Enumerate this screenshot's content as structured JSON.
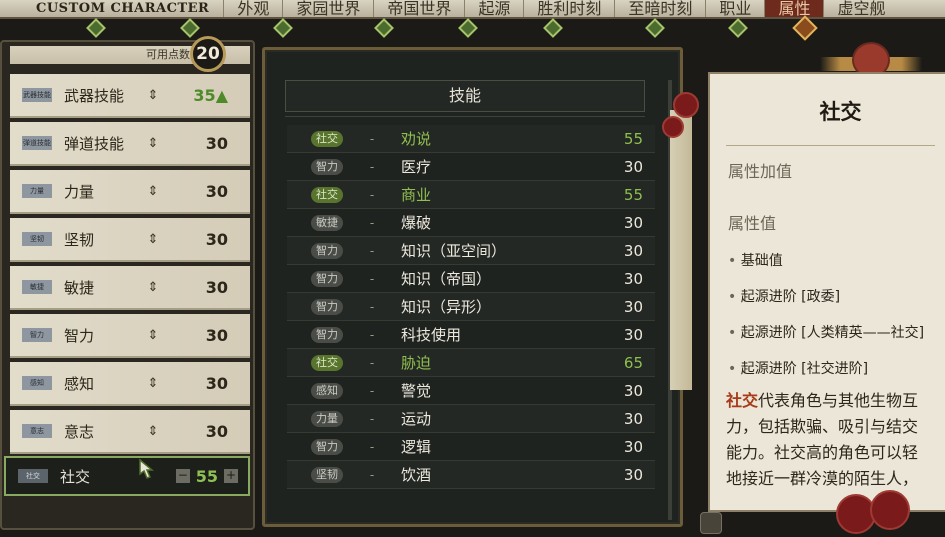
{
  "topbar": {
    "title": "CUSTOM CHARACTER",
    "tabs": [
      "外观",
      "家园世界",
      "帝国世界",
      "起源",
      "胜利时刻",
      "至暗时刻",
      "职业",
      "属性",
      "虚空舰"
    ]
  },
  "points": {
    "label": "可用点数",
    "value": "20"
  },
  "characteristics": [
    {
      "badge": "武器技能",
      "name": "武器技能",
      "value": "35▲",
      "highlight": true
    },
    {
      "badge": "弹道技能",
      "name": "弹道技能",
      "value": "30"
    },
    {
      "badge": "力量",
      "name": "力量",
      "value": "30"
    },
    {
      "badge": "坚韧",
      "name": "坚韧",
      "value": "30"
    },
    {
      "badge": "敏捷",
      "name": "敏捷",
      "value": "30"
    },
    {
      "badge": "智力",
      "name": "智力",
      "value": "30"
    },
    {
      "badge": "感知",
      "name": "感知",
      "value": "30"
    },
    {
      "badge": "意志",
      "name": "意志",
      "value": "30"
    }
  ],
  "selected_characteristic": {
    "badge": "社交",
    "name": "社交",
    "value": "55",
    "minus": "−",
    "plus": "+"
  },
  "skills": {
    "title": "技能",
    "rows": [
      {
        "attr": "社交",
        "name": "劝说",
        "value": "55",
        "social": true
      },
      {
        "attr": "智力",
        "name": "医疗",
        "value": "30"
      },
      {
        "attr": "社交",
        "name": "商业",
        "value": "55",
        "social": true
      },
      {
        "attr": "敏捷",
        "name": "爆破",
        "value": "30"
      },
      {
        "attr": "智力",
        "name": "知识（亚空间）",
        "value": "30"
      },
      {
        "attr": "智力",
        "name": "知识（帝国）",
        "value": "30"
      },
      {
        "attr": "智力",
        "name": "知识（异形）",
        "value": "30"
      },
      {
        "attr": "智力",
        "name": "科技使用",
        "value": "30"
      },
      {
        "attr": "社交",
        "name": "胁迫",
        "value": "65",
        "social": true
      },
      {
        "attr": "感知",
        "name": "警觉",
        "value": "30"
      },
      {
        "attr": "力量",
        "name": "运动",
        "value": "30"
      },
      {
        "attr": "智力",
        "name": "逻辑",
        "value": "30"
      },
      {
        "attr": "坚韧",
        "name": "饮酒",
        "value": "30"
      }
    ]
  },
  "detail": {
    "title": "社交",
    "section_bonus": "属性加值",
    "section_value": "属性值",
    "lines": [
      "基础值",
      "起源进阶 [政委]",
      "起源进阶 [人类精英——社交]",
      "起源进阶 [社交进阶]"
    ],
    "desc_highlight": "社交",
    "desc_lines": [
      "代表角色与其他生物互",
      "力，包括欺骗、吸引与结交",
      "能力。社交高的角色可以轻",
      "地接近一群冷漠的陌生人，"
    ]
  },
  "colors": {
    "accent_green": "#8fbf4f",
    "social_badge": "#58742d",
    "active_tab": "#6e2a1c",
    "highlight_red": "#a63a1a"
  }
}
